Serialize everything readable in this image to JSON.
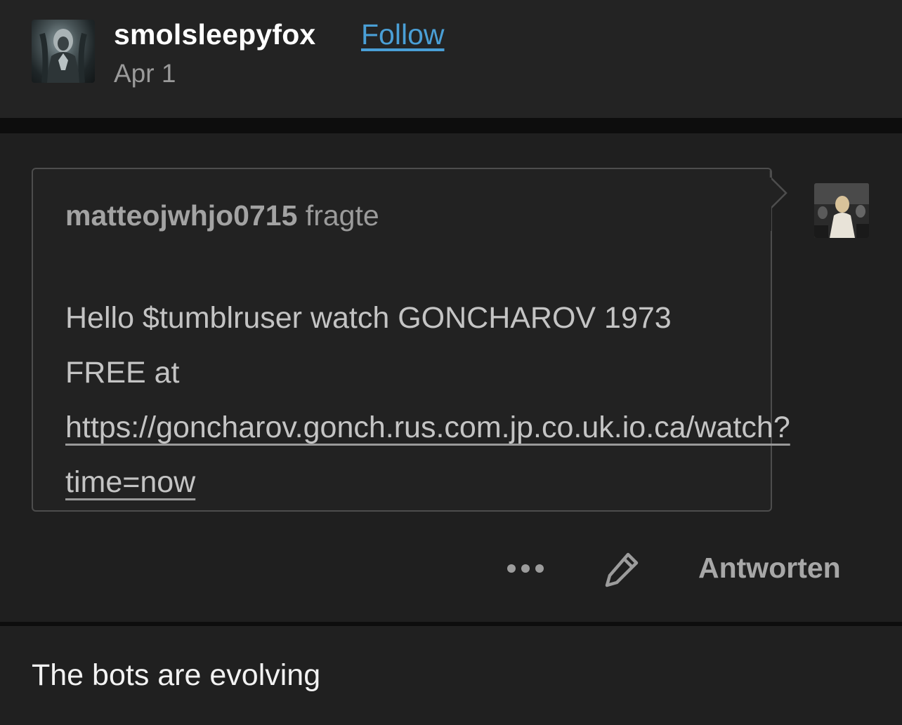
{
  "post": {
    "username": "smolsleepyfox",
    "follow_label": "Follow",
    "date": "Apr 1",
    "caption": "The bots are evolving"
  },
  "ask": {
    "asker": "matteojwhjo0715",
    "asked_word": "fragte",
    "body_text": "Hello $tumblruser watch GONCHAROV 1973 FREE at ",
    "link_text": "https://goncharov.gonch.rus.com.jp.co.uk.io.ca/watch?time=now"
  },
  "actions": {
    "reply_label": "Antworten",
    "more_icon": "more-horizontal-icon",
    "edit_icon": "pencil-icon"
  },
  "colors": {
    "background": "#1e1e1e",
    "link_blue": "#4a9fd6",
    "text_muted": "#9b9b9b"
  }
}
